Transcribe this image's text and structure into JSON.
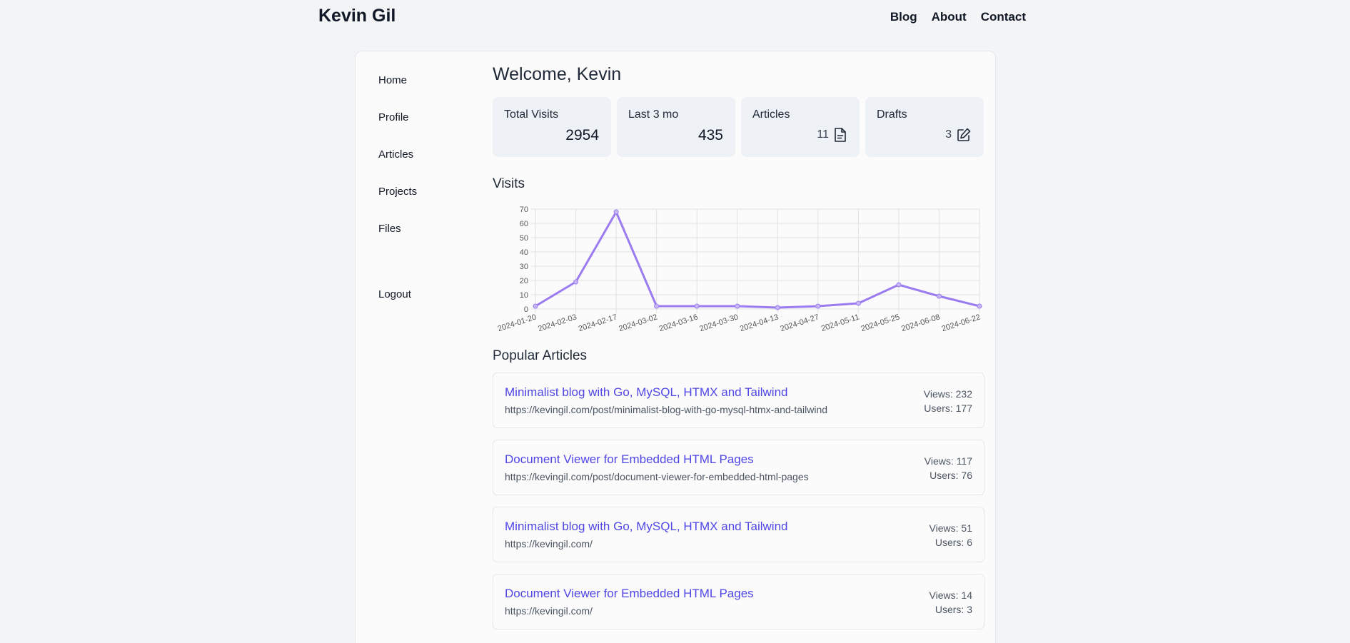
{
  "header": {
    "brand": "Kevin Gil",
    "nav": [
      "Blog",
      "About",
      "Contact"
    ]
  },
  "sidebar": {
    "items": [
      "Home",
      "Profile",
      "Articles",
      "Projects",
      "Files"
    ],
    "logout": "Logout"
  },
  "main": {
    "welcome": "Welcome, Kevin",
    "stats": {
      "total_visits_label": "Total Visits",
      "total_visits_value": "2954",
      "last3_label": "Last 3 mo",
      "last3_value": "435",
      "articles_label": "Articles",
      "articles_value": "11",
      "drafts_label": "Drafts",
      "drafts_value": "3"
    },
    "visits_title": "Visits",
    "popular_title": "Popular Articles",
    "articles": [
      {
        "title": "Minimalist blog with Go, MySQL, HTMX and Tailwind",
        "url": "https://kevingil.com/post/minimalist-blog-with-go-mysql-htmx-and-tailwind",
        "views": "Views: 232",
        "users": "Users: 177"
      },
      {
        "title": "Document Viewer for Embedded HTML Pages",
        "url": "https://kevingil.com/post/document-viewer-for-embedded-html-pages",
        "views": "Views: 117",
        "users": "Users: 76"
      },
      {
        "title": "Minimalist blog with Go, MySQL, HTMX and Tailwind",
        "url": "https://kevingil.com/",
        "views": "Views: 51",
        "users": "Users: 6"
      },
      {
        "title": "Document Viewer for Embedded HTML Pages",
        "url": "https://kevingil.com/",
        "views": "Views: 14",
        "users": "Users: 3"
      }
    ]
  },
  "colors": {
    "accent_line": "#9b7bf0",
    "link": "#4f46e5",
    "stat_bg": "#eef1f6"
  },
  "chart_data": {
    "type": "line",
    "title": "",
    "xlabel": "",
    "ylabel": "",
    "categories": [
      "2024-01-20",
      "2024-02-03",
      "2024-02-17",
      "2024-03-02",
      "2024-03-16",
      "2024-03-30",
      "2024-04-13",
      "2024-04-27",
      "2024-05-11",
      "2024-05-25",
      "2024-06-08",
      "2024-06-22"
    ],
    "values": [
      2,
      19,
      68,
      2,
      2,
      2,
      1,
      2,
      4,
      17,
      9,
      2
    ],
    "ylim": [
      0,
      70
    ],
    "yticks": [
      0,
      10,
      20,
      30,
      40,
      50,
      60,
      70
    ],
    "grid": true,
    "legend": "none"
  }
}
